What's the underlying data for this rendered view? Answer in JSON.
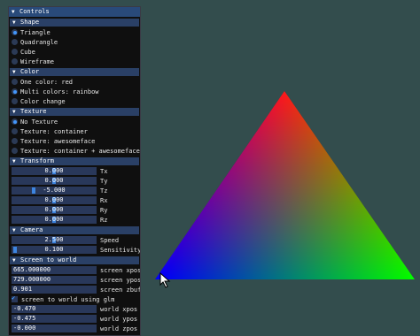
{
  "window": {
    "title": "Controls"
  },
  "shape": {
    "header": "Shape",
    "options": [
      {
        "label": "Triangle",
        "selected": true
      },
      {
        "label": "Quadrangle",
        "selected": false
      },
      {
        "label": "Cube",
        "selected": false
      },
      {
        "label": "Wireframe",
        "selected": false
      }
    ]
  },
  "color": {
    "header": "Color",
    "options": [
      {
        "label": "One color: red",
        "selected": false
      },
      {
        "label": "Multi colors: rainbow",
        "selected": true
      },
      {
        "label": "Color change",
        "selected": false
      }
    ]
  },
  "texture": {
    "header": "Texture",
    "options": [
      {
        "label": "No Texture",
        "selected": true
      },
      {
        "label": "Texture: container",
        "selected": false
      },
      {
        "label": "Texture: awesomeface",
        "selected": false
      },
      {
        "label": "Texture: container + awesomeface",
        "selected": false
      }
    ]
  },
  "transform": {
    "header": "Transform",
    "sliders": [
      {
        "value": "0.000",
        "label": "Tx",
        "level": 0.5
      },
      {
        "value": "0.000",
        "label": "Ty",
        "level": 0.5
      },
      {
        "value": "-5.000",
        "label": "Tz",
        "level": 0.25
      },
      {
        "value": "0.000",
        "label": "Rx",
        "level": 0.5
      },
      {
        "value": "0.000",
        "label": "Ry",
        "level": 0.5
      },
      {
        "value": "0.000",
        "label": "Rz",
        "level": 0.5
      }
    ]
  },
  "camera": {
    "header": "Camera",
    "sliders": [
      {
        "value": "2.500",
        "label": "Speed",
        "level": 0.5
      },
      {
        "value": "0.100",
        "label": "Sensitivity",
        "level": 0.02
      }
    ]
  },
  "screen_to_world": {
    "header": "Screen to world",
    "screen_fields": [
      {
        "value": "665.000000",
        "label": "screen xpos"
      },
      {
        "value": "729.000000",
        "label": "screen ypos"
      },
      {
        "value": "0.901",
        "label": "screen zbuf"
      }
    ],
    "glm_checkbox": {
      "label": "screen to world using glm",
      "checked": true
    },
    "world_fields": [
      {
        "value": "-0.470",
        "label": "world xpos"
      },
      {
        "value": "-0.475",
        "label": "world ypos"
      },
      {
        "value": "-0.000",
        "label": "world zpos"
      }
    ]
  },
  "colors": {
    "background": "#334d4d",
    "vertex_top": "#ff0000",
    "vertex_left": "#0000ff",
    "vertex_right": "#00ff00",
    "accent": "#4296fa"
  }
}
